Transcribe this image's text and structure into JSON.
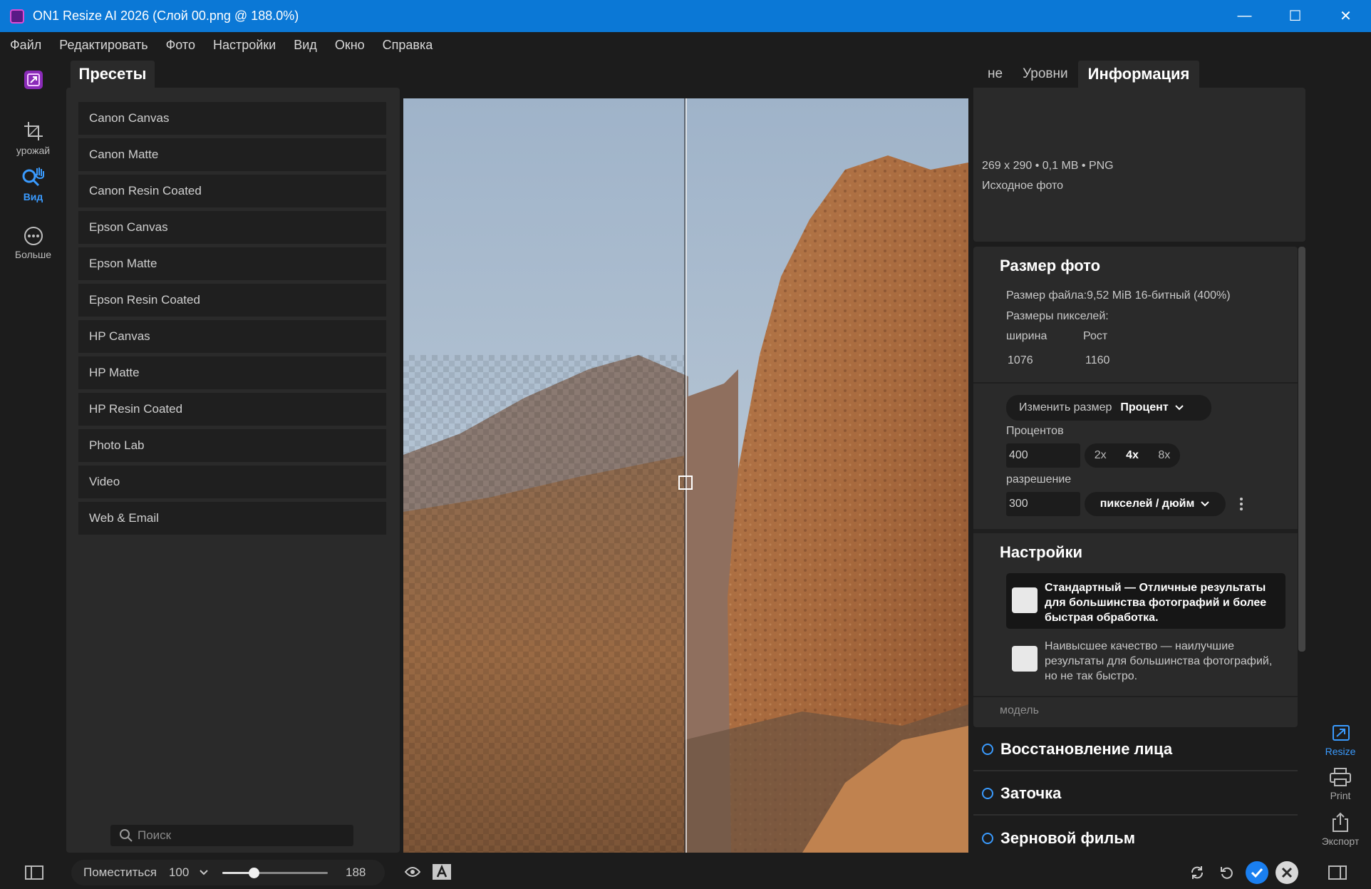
{
  "window": {
    "title": "ON1 Resize AI 2026 (Слой 00.png @ 188.0%)",
    "minimize": "—",
    "maximize": "☐",
    "close": "✕"
  },
  "menu": [
    "Файл",
    "Редактировать",
    "Фото",
    "Настройки",
    "Вид",
    "Окно",
    "Справка"
  ],
  "left_tools": {
    "crop": "урожай",
    "view": "Вид",
    "more": "Больше"
  },
  "presets": {
    "tab": "Пресеты",
    "items": [
      "Canon Canvas",
      "Canon Matte",
      "Canon Resin Coated",
      "Epson Canvas",
      "Epson Matte",
      "Epson Resin Coated",
      "HP Canvas",
      "HP Matte",
      "HP Resin Coated",
      "Photo Lab",
      "Video",
      "Web & Email"
    ],
    "search_placeholder": "Поиск"
  },
  "right_tabs": [
    "не",
    "Уровни",
    "Информация"
  ],
  "info": {
    "line1": "269 x 290 • 0,1 MB • PNG",
    "line2": "Исходное фото"
  },
  "photo_size": {
    "title": "Размер фото",
    "file_size": "Размер файла:9,52 MiB 16-битный (400%)",
    "pixel_dims": "Размеры пикселей:",
    "width_label": "ширина",
    "height_label": "Рост",
    "width_value": "1076",
    "height_value": "1160",
    "resize_label": "Изменить размер",
    "resize_mode": "Процент",
    "percent_label": "Процентов",
    "percent_value": "400",
    "multipliers": [
      "2x",
      "4x",
      "8x"
    ],
    "multiplier_selected": "4x",
    "resolution_label": "разрешение",
    "resolution_value": "300",
    "resolution_unit": "пикселей / дюйм"
  },
  "settings": {
    "title": "Настройки",
    "standard": "Стандартный — Отличные результаты для большинства фотографий и более быстрая обработка.",
    "highest": "Наивысшее качество — наилучшие результаты для большинства фотографий, но не так быстро.",
    "model_label": "модель"
  },
  "sections": [
    "Восстановление лица",
    "Заточка",
    "Зерновой фильм"
  ],
  "right_tools": {
    "resize": "Resize",
    "print": "Print",
    "export": "Экспорт"
  },
  "bottom": {
    "fit": "Поместиться",
    "zoom_preset": "100",
    "zoom_value": "188",
    "zoom_fraction": 0.3
  },
  "colors": {
    "accent": "#0b78d6",
    "active_blue": "#3a9bff",
    "panel": "#2a2a2a",
    "background": "#1c1c1c"
  }
}
